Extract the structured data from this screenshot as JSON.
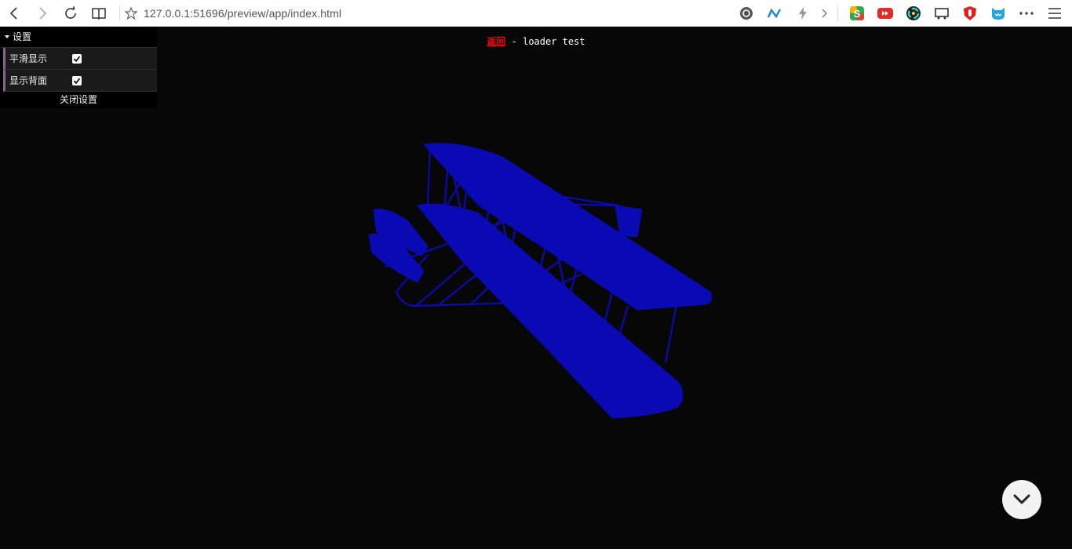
{
  "browser": {
    "url": "127.0.0.1:51696/preview/app/index.html",
    "icons": {
      "back": "back-arrow-icon",
      "forward": "forward-arrow-icon",
      "reload": "reload-icon",
      "reading": "reading-view-icon",
      "favorite": "favorite-star-icon",
      "more": "more-dots-icon",
      "menu": "hamburger-menu-icon"
    }
  },
  "page": {
    "back_link": "返回",
    "separator": " - ",
    "title": "loader test"
  },
  "gui": {
    "folder_title": "设置",
    "controls": [
      {
        "label": "平滑显示",
        "checked": true
      },
      {
        "label": "显示背面",
        "checked": true
      }
    ],
    "close_label": "关闭设置"
  },
  "scene": {
    "background": "#070707",
    "model_color": "#0a0ab4"
  }
}
